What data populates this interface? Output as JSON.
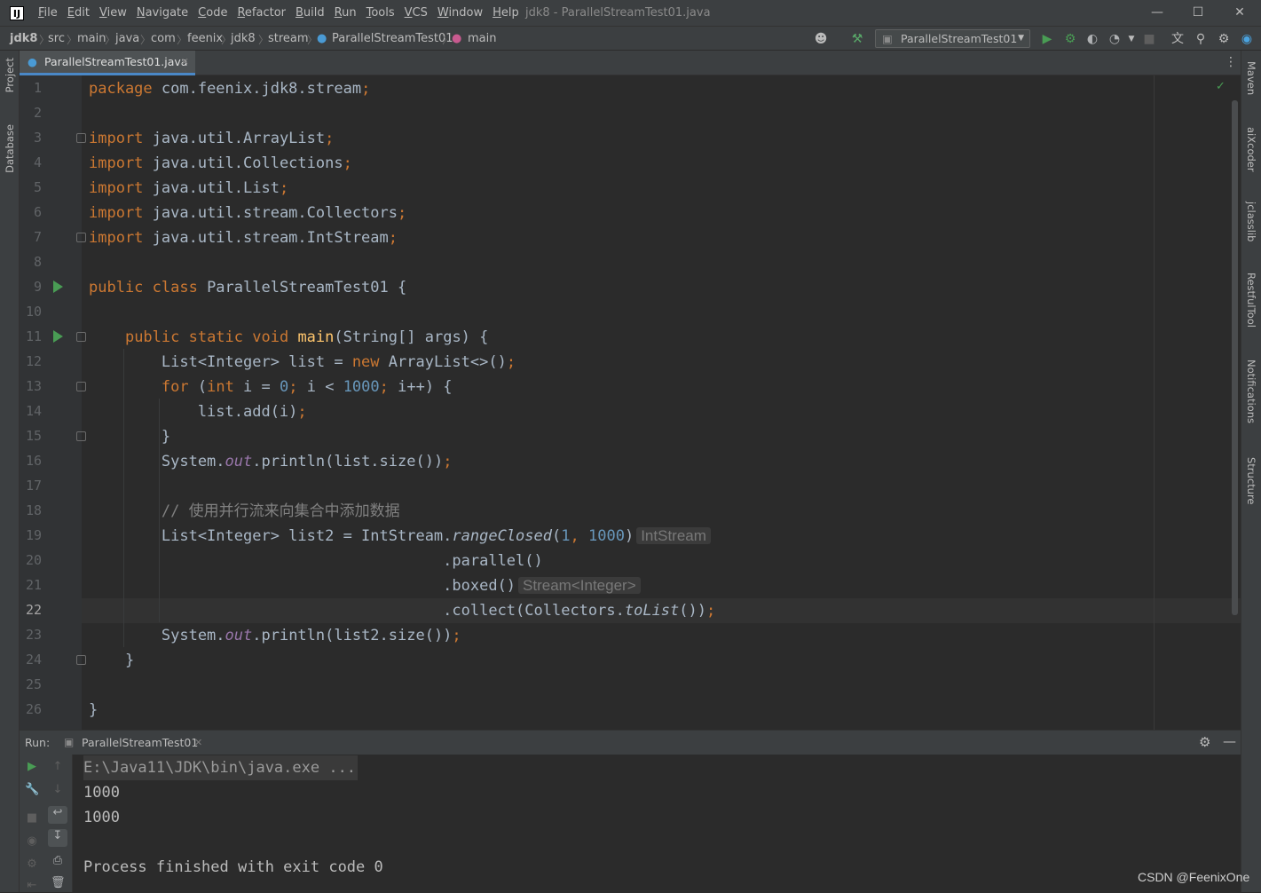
{
  "app": {
    "logo": "IJ",
    "window_title": "jdk8 - ParallelStreamTest01.java"
  },
  "menu": [
    {
      "u": "F",
      "rest": "ile"
    },
    {
      "u": "E",
      "rest": "dit"
    },
    {
      "u": "V",
      "rest": "iew"
    },
    {
      "u": "N",
      "rest": "avigate"
    },
    {
      "u": "C",
      "rest": "ode"
    },
    {
      "u": "R",
      "rest": "efactor"
    },
    {
      "u": "B",
      "rest": "uild"
    },
    {
      "u": "R",
      "rest": "un"
    },
    {
      "u": "T",
      "rest": "ools"
    },
    {
      "u": "V",
      "rest": "CS"
    },
    {
      "u": "W",
      "rest": "indow"
    },
    {
      "u": "H",
      "rest": "elp"
    }
  ],
  "breadcrumbs": [
    "jdk8",
    "src",
    "main",
    "java",
    "com",
    "feenix",
    "jdk8",
    "stream",
    "ParallelStreamTest01",
    "main"
  ],
  "run_config": "ParallelStreamTest01",
  "left_tabs": [
    "Project",
    "Database"
  ],
  "right_tabs": [
    "Maven",
    "aiXcoder",
    "jclasslib",
    "RestfulTool",
    "Notifications",
    "Structure"
  ],
  "editor": {
    "file_tab": "ParallelStreamTest01.java",
    "current_line": 22,
    "line_numbers": [
      1,
      2,
      3,
      4,
      5,
      6,
      7,
      8,
      9,
      10,
      11,
      12,
      13,
      14,
      15,
      16,
      17,
      18,
      19,
      20,
      21,
      22,
      23,
      24,
      25,
      26
    ],
    "hints": {
      "line19": "IntStream",
      "line21": "Stream<Integer>"
    }
  },
  "run_panel": {
    "label": "Run:",
    "tab": "ParallelStreamTest01"
  },
  "console": {
    "lines": [
      "E:\\Java11\\JDK\\bin\\java.exe ...",
      "1000",
      "1000",
      "",
      "Process finished with exit code 0"
    ]
  },
  "watermark": "CSDN @FeenixOne",
  "colors": {
    "keyword": "#cc7832",
    "number": "#6897bb",
    "comment": "#808080",
    "method": "#ffc66d",
    "field": "#9876aa",
    "text": "#a9b7c6",
    "run_green": "#499c54"
  }
}
